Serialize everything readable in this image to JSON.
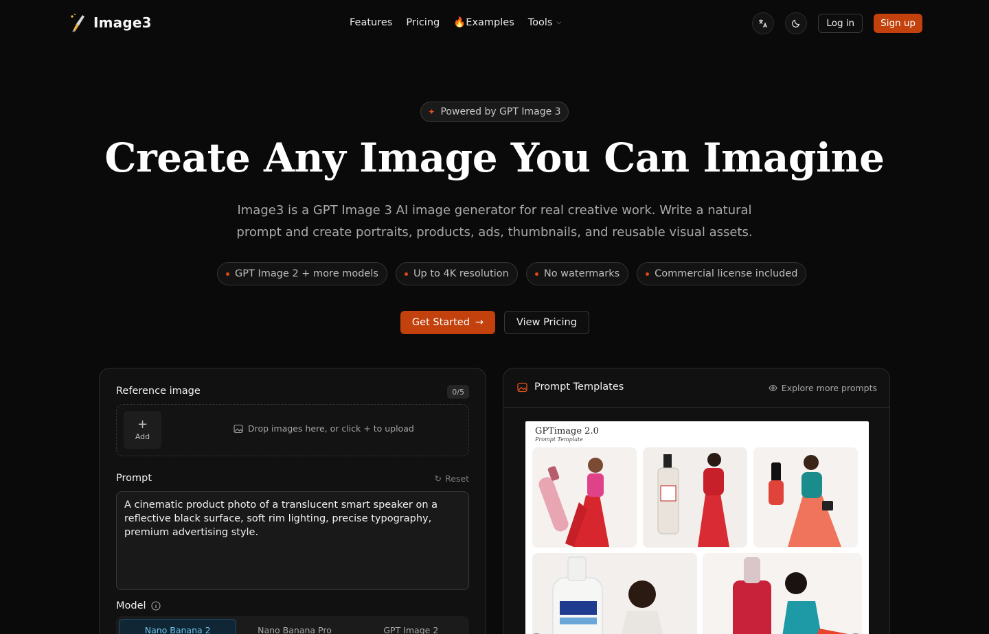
{
  "brand": {
    "name": "Image3"
  },
  "nav": {
    "features": "Features",
    "pricing": "Pricing",
    "examples": "🔥Examples",
    "tools": "Tools"
  },
  "header": {
    "login": "Log in",
    "signup": "Sign up"
  },
  "hero": {
    "badge": "Powered by GPT Image 3",
    "title": "Create Any Image You Can Imagine",
    "subtitle": "Image3 is a GPT Image 3 AI image generator for real creative work. Write a natural prompt and create portraits, products, ads, thumbnails, and reusable visual assets.",
    "pills": [
      "GPT Image 2 + more models",
      "Up to 4K resolution",
      "No watermarks",
      "Commercial license included"
    ],
    "cta_primary": "Get Started",
    "cta_secondary": "View Pricing"
  },
  "generator": {
    "reference_label": "Reference image",
    "reference_count": "0/5",
    "add_label": "Add",
    "drop_hint": "Drop images here, or click + to upload",
    "prompt_label": "Prompt",
    "reset_label": "Reset",
    "prompt_text": "A cinematic product photo of a translucent smart speaker on a reflective black surface, soft rim lighting, precise typography, premium advertising style.",
    "model_label": "Model",
    "models": [
      "Nano Banana 2",
      "Nano Banana Pro",
      "GPT Image 2"
    ],
    "selected_model": "Nano Banana 2"
  },
  "templates": {
    "title": "Prompt Templates",
    "explore": "Explore more prompts",
    "card_brand": "GPTimage 2.0",
    "card_subtitle": "Prompt Template"
  },
  "colors": {
    "accent": "#c2410c",
    "background": "#0b0a0a",
    "panel": "#121111",
    "model_active": "#6ec6f0"
  }
}
